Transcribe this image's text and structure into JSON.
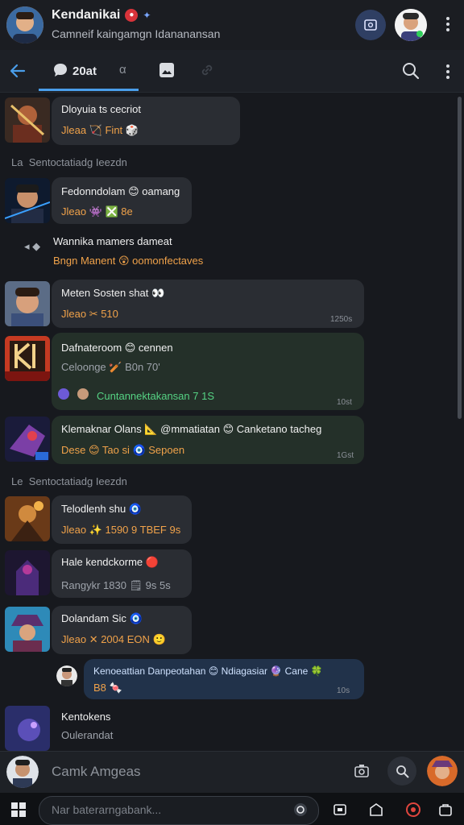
{
  "header": {
    "title": "Kendanikai",
    "subtitle": "Camneif kaingamgn Idananansan",
    "colors": {
      "accent": "#4a9eea",
      "badge": "#d8333a",
      "call_button": "#2f3f63"
    },
    "icons": {
      "badge": "red-badge-icon",
      "verified": "diamond-icon",
      "call": "video-call-icon",
      "menu": "kebab-menu-icon"
    }
  },
  "tabs": {
    "back_icon": "back-arrow-icon",
    "items": [
      {
        "label": "20at",
        "icon": "chat-bubble-icon"
      },
      {
        "label": "α"
      },
      {
        "label": "",
        "icon": "gallery-icon"
      },
      {
        "label": "",
        "icon": "link-icon"
      }
    ],
    "search_icon": "search-icon",
    "menu_icon": "kebab-menu-icon"
  },
  "messages": [
    {
      "title": "Dloyuia ts cecriot",
      "meta": "Jleaa 🏹 Fint 🎲",
      "time": ""
    },
    {
      "separator": "Sentoctatiadg Ieezdn",
      "prefix": "La"
    },
    {
      "title": "Fedonndolam 😊 oamang",
      "meta": "Jleao 👾 ❎ 8e",
      "time": ""
    },
    {
      "title": "Wannika mamers dameat",
      "meta": "Bngn Manent 😲 oomonfectaves",
      "time": ""
    },
    {
      "title": "Meten Sosten shat 👀",
      "meta": "Jleao ✂ 510",
      "time": "1250s"
    },
    {
      "title": "Dafnateroom 😊 cennen",
      "meta": "Celoonge 🏏 B0n 70'",
      "line3": "Cuntannektakansan 7 1S",
      "time": "10st"
    },
    {
      "title": "Klemaknar Olans 📐 @mmatiatan 😊 Canketano tacheg",
      "meta": "Dese 😊 Tao si 🧿 Sepoen",
      "time": "1Gst"
    },
    {
      "separator": "Sentoctatiadg Ieezdn",
      "prefix": "Le"
    },
    {
      "title": "Telodlenh shu 🧿",
      "meta": "Jleao ✨ 1590 9 TBEF 9s",
      "time": ""
    },
    {
      "title": "Hale kendckorme 🔴",
      "meta": "Rangykr 1830 🗒 9s 5s",
      "time": ""
    },
    {
      "title": "Dolandam Sic 🧿",
      "meta": "Jleao ✕ 2004 EON 🙂",
      "time": ""
    },
    {
      "title": "Kenoeattian Danpeotahan 😊 Ndiagasiar 🔮 Cane 🍀",
      "meta": "B8 🍬",
      "time": "10s"
    },
    {
      "title": "Kentokens",
      "meta": "Oulerandat",
      "time": ""
    }
  ],
  "composer": {
    "placeholder": "Camk Amgeas",
    "icons": [
      "camera-icon",
      "mention-icon"
    ]
  },
  "system_bar": {
    "search_placeholder": "Nar baterarngabank...",
    "icons": [
      "windows-icon",
      "copilot-icon",
      "task-view-icon",
      "explorer-icon",
      "browser-icon",
      "store-icon"
    ]
  }
}
